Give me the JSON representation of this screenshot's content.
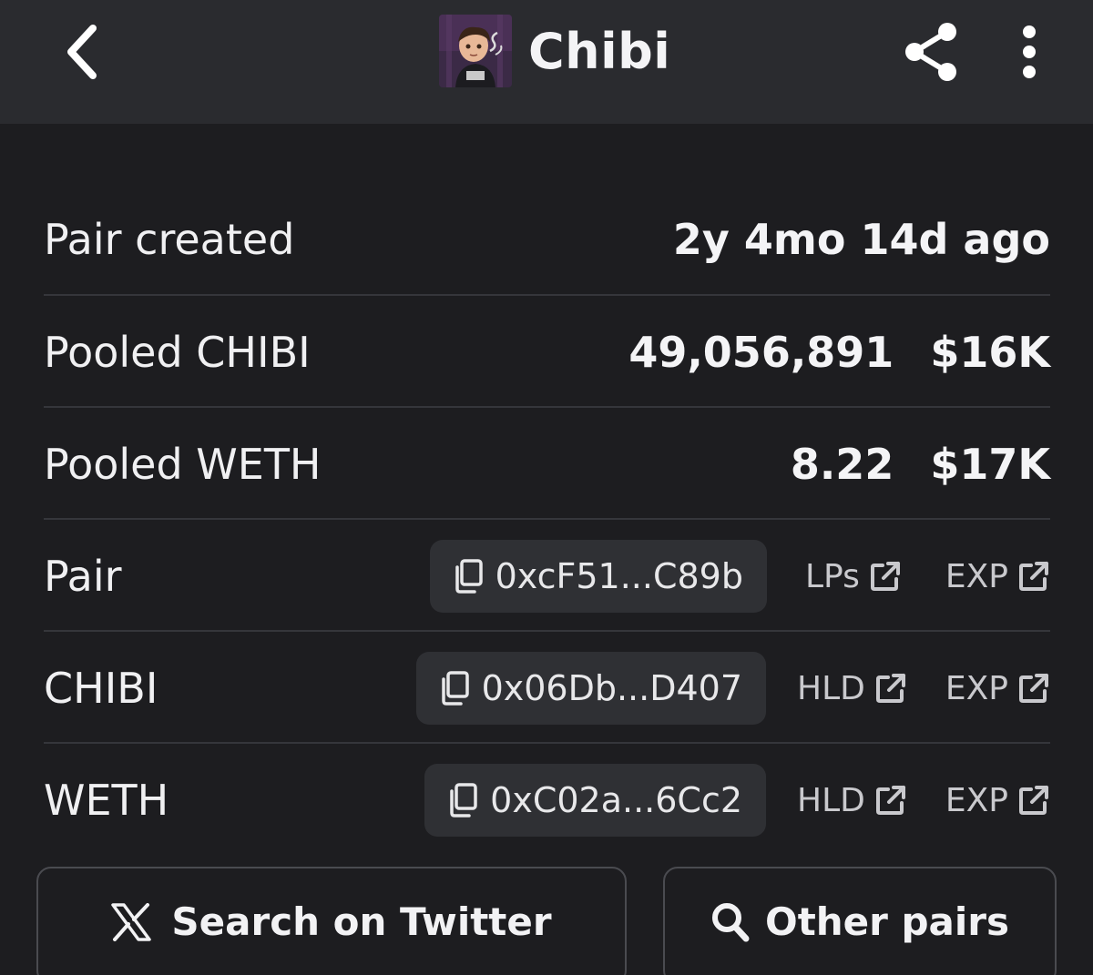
{
  "header": {
    "title": "Chibi",
    "back_icon": "chevron-left-icon",
    "share_icon": "share-icon",
    "more_icon": "more-vertical-icon"
  },
  "info": {
    "pair_created": {
      "label": "Pair created",
      "value": "2y 4mo 14d ago"
    },
    "pooled_chibi": {
      "label": "Pooled CHIBI",
      "amount": "49,056,891",
      "usd": "$16K"
    },
    "pooled_weth": {
      "label": "Pooled WETH",
      "amount": "8.22",
      "usd": "$17K"
    }
  },
  "addresses": [
    {
      "label": "Pair",
      "address": "0xcF51...C89b",
      "link1": "LPs",
      "link2": "EXP"
    },
    {
      "label": "CHIBI",
      "address": "0x06Db...D407",
      "link1": "HLD",
      "link2": "EXP"
    },
    {
      "label": "WETH",
      "address": "0xC02a...6Cc2",
      "link1": "HLD",
      "link2": "EXP"
    }
  ],
  "buttons": {
    "twitter": "Search on Twitter",
    "other_pairs": "Other pairs"
  },
  "colors": {
    "background": "#1d1d20",
    "header": "#2a2b2f",
    "chip": "#2f3034",
    "divider": "#35363b",
    "text": "#f2f2f4",
    "muted": "#c9c9cd"
  }
}
